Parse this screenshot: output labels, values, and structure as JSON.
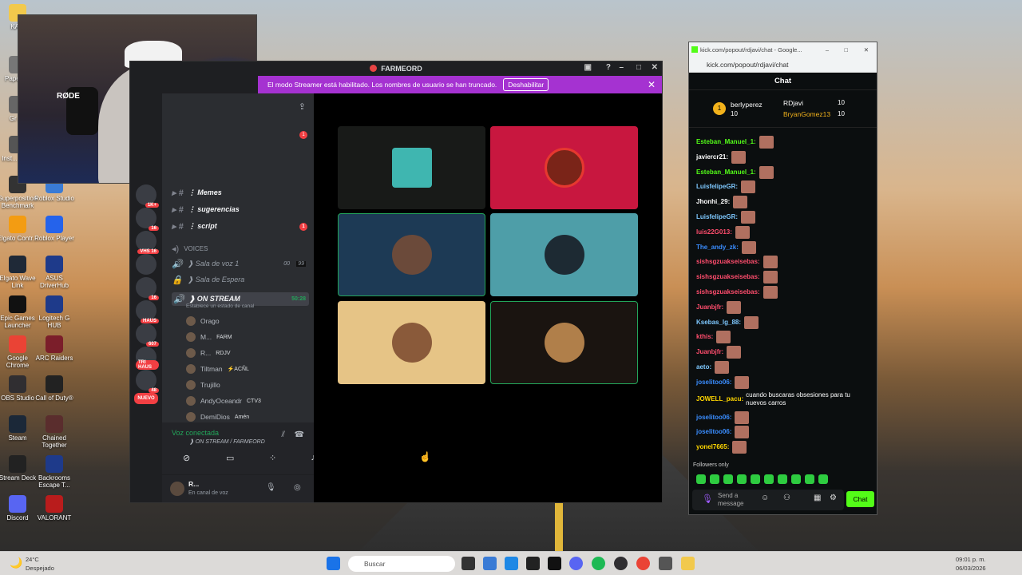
{
  "desktop": {
    "icons": [
      {
        "label": "KA..."
      },
      {
        "label": "Pape rec"
      },
      {
        "label": "Gr Au"
      },
      {
        "label": "Inst... Grab"
      },
      {
        "label": "Superposition Benchmark"
      },
      {
        "label": "Roblox Studio"
      },
      {
        "label": "Elgato Contr..."
      },
      {
        "label": "Roblox Player"
      },
      {
        "label": "Elgato Wave Link"
      },
      {
        "label": "ASUS DriverHub"
      },
      {
        "label": "Epic Games Launcher"
      },
      {
        "label": "Logitech G HUB"
      },
      {
        "label": "Google Chrome"
      },
      {
        "label": "ARC Raiders"
      },
      {
        "label": "OBS Studio"
      },
      {
        "label": "Call of Duty®"
      },
      {
        "label": "Steam"
      },
      {
        "label": "Chained Together"
      },
      {
        "label": "Stream Deck"
      },
      {
        "label": "Backrooms Escape T..."
      },
      {
        "label": "Discord"
      },
      {
        "label": "VALORANT"
      }
    ]
  },
  "webcam": {
    "mic_brand": "RØDE"
  },
  "discord": {
    "title": "FARMEORD",
    "banner": {
      "text": "El modo Streamer está habilitado. Los nombres de usuario se han truncado.",
      "button": "Deshabilitar"
    },
    "servers": [
      {
        "label": "1K+"
      },
      {
        "label": "16"
      },
      {
        "label": "VHS 16"
      },
      {
        "label": ""
      },
      {
        "label": "16"
      },
      {
        "label": "HAUS"
      },
      {
        "label": "607"
      },
      {
        "label": "TRI HAUS"
      },
      {
        "label": "48"
      },
      {
        "label": "NUEVO"
      }
    ],
    "channels": {
      "memes": "⋮ Memes",
      "sugerencias": "⋮ sugerencias",
      "script": "⋮ script",
      "voices": "VOICES",
      "voz1": "❱ Sala de voz 1",
      "voz1_count_a": "00",
      "voz1_count_b": "99",
      "espera": "❱ Sala de Espera",
      "onstream": "❱ ON STREAM",
      "onstream_time": "50:28",
      "onstream_sub": "Establece un estado de canal"
    },
    "users": [
      {
        "name": "Orago",
        "tag": ""
      },
      {
        "name": "M...",
        "tag": "FARM"
      },
      {
        "name": "R...",
        "tag": "RDJV"
      },
      {
        "name": "Tiltman",
        "tag": "⚡ACÑL"
      },
      {
        "name": "Trujillo",
        "tag": ""
      },
      {
        "name": "AndyOceandr",
        "tag": "CTV3"
      },
      {
        "name": "DemiDios",
        "tag": "Amén"
      }
    ],
    "voice": {
      "status": "Voz conectada",
      "channel": "❱ ON STREAM / FARMEORD"
    },
    "user": {
      "name": "R...",
      "status": "En canal de voz"
    }
  },
  "kick": {
    "window_title": "kick.com/popout/rdjavi/chat - Google...",
    "url": "kick.com/popout/rdjavi/chat",
    "header": "Chat",
    "top": [
      {
        "name": "berlyperez",
        "value": "10"
      },
      {
        "name": "RDjavi",
        "value": "10"
      },
      {
        "name": "BryanGomez13",
        "value": "10"
      }
    ],
    "top_rank": "1",
    "messages": [
      {
        "user": "Esteban_Manuel_1:",
        "color": "#53fc18",
        "text": ""
      },
      {
        "user": "javiercr21:",
        "color": "#ffffff",
        "text": ""
      },
      {
        "user": "Esteban_Manuel_1:",
        "color": "#53fc18",
        "text": ""
      },
      {
        "user": "LuisfelipeGR:",
        "color": "#7ec8ff",
        "text": ""
      },
      {
        "user": "Jhonhi_29:",
        "color": "#ffffff",
        "text": ""
      },
      {
        "user": "LuisfelipeGR:",
        "color": "#7ec8ff",
        "text": ""
      },
      {
        "user": "luis22G013:",
        "color": "#ff4d6d",
        "text": ""
      },
      {
        "user": "The_andy_zk:",
        "color": "#3a8dff",
        "text": ""
      },
      {
        "user": "sishsgzuakseisebas:",
        "color": "#ff4d6d",
        "text": ""
      },
      {
        "user": "sishsgzuakseisebas:",
        "color": "#ff4d6d",
        "text": ""
      },
      {
        "user": "sishsgzuakseisebas:",
        "color": "#ff4d6d",
        "text": ""
      },
      {
        "user": "Juanbjfr:",
        "color": "#ff4d6d",
        "text": ""
      },
      {
        "user": "Ksebas_lg_88:",
        "color": "#7ec8ff",
        "text": ""
      },
      {
        "user": "kthis:",
        "color": "#ff4d6d",
        "text": ""
      },
      {
        "user": "Juanbjfr:",
        "color": "#ff4d6d",
        "text": ""
      },
      {
        "user": "aeto:",
        "color": "#7ec8ff",
        "text": ""
      },
      {
        "user": "joselitoo06:",
        "color": "#3a8dff",
        "text": ""
      },
      {
        "user": "JOWELL_pacu:",
        "color": "#ffd700",
        "text": "cuando buscaras obsesiones para tu nuevos carros"
      },
      {
        "user": "joselitoo06:",
        "color": "#3a8dff",
        "text": ""
      },
      {
        "user": "joselitoo06:",
        "color": "#3a8dff",
        "text": ""
      },
      {
        "user": "yonel7665:",
        "color": "#ffd700",
        "text": ""
      }
    ],
    "followers": "Followers only",
    "input_placeholder": "Send a message",
    "chat_button": "Chat"
  },
  "taskbar": {
    "weather_temp": "24°C",
    "weather_desc": "Despejado",
    "search": "Buscar",
    "time": "09:01 p. m.",
    "date": "06/03/2026"
  }
}
